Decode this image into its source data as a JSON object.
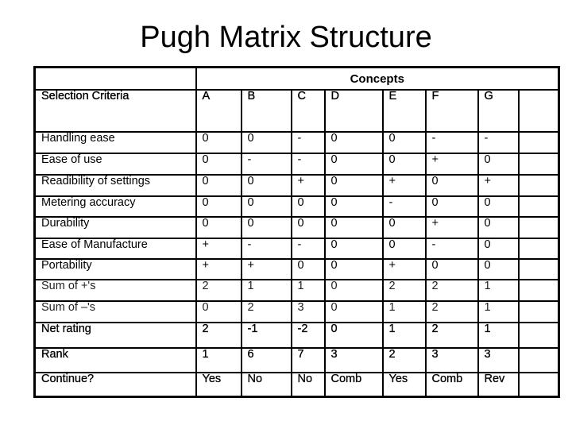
{
  "title": "Pugh Matrix Structure",
  "table": {
    "group_header": "Concepts",
    "criteria_header": "Selection Criteria",
    "concepts": [
      "A",
      "B",
      "C",
      "D",
      "E",
      "F",
      "G",
      ""
    ],
    "criteria_rows": [
      {
        "label": "Handling ease",
        "values": [
          "0",
          "0",
          "-",
          "0",
          "0",
          "-",
          "-",
          ""
        ]
      },
      {
        "label": "Ease of use",
        "values": [
          "0",
          "-",
          "-",
          "0",
          "0",
          "+",
          "0",
          ""
        ]
      },
      {
        "label": "Readibility of settings",
        "values": [
          "0",
          "0",
          "+",
          "0",
          "+",
          "0",
          "+",
          ""
        ]
      },
      {
        "label": "Metering accuracy",
        "values": [
          "0",
          "0",
          "0",
          "0",
          "-",
          "0",
          "0",
          ""
        ]
      },
      {
        "label": "Durability",
        "values": [
          "0",
          "0",
          "0",
          "0",
          "0",
          "+",
          "0",
          ""
        ]
      },
      {
        "label": "Ease of Manufacture",
        "values": [
          "+",
          "-",
          "-",
          "0",
          "0",
          "-",
          "0",
          ""
        ]
      },
      {
        "label": "Portability",
        "values": [
          "+",
          "+",
          "0",
          "0",
          "+",
          "0",
          "0",
          ""
        ]
      }
    ],
    "sum_rows": [
      {
        "label": "Sum of +'s",
        "values": [
          "2",
          "1",
          "1",
          "0",
          "2",
          "2",
          "1",
          ""
        ]
      },
      {
        "label": "Sum of –'s",
        "values": [
          "0",
          "2",
          "3",
          "0",
          "1",
          "2",
          "1",
          ""
        ]
      }
    ],
    "net_rating": {
      "label": "Net rating",
      "values": [
        "2",
        "-1",
        "-2",
        "0",
        "1",
        "2",
        "1",
        ""
      ]
    },
    "rank": {
      "label": "Rank",
      "values": [
        "1",
        "6",
        "7",
        "3",
        "2",
        "3",
        "3",
        ""
      ]
    },
    "continue": {
      "label": "Continue?",
      "values": [
        "Yes",
        "No",
        "No",
        "Comb",
        "Yes",
        "Comb",
        "Rev",
        ""
      ]
    }
  }
}
